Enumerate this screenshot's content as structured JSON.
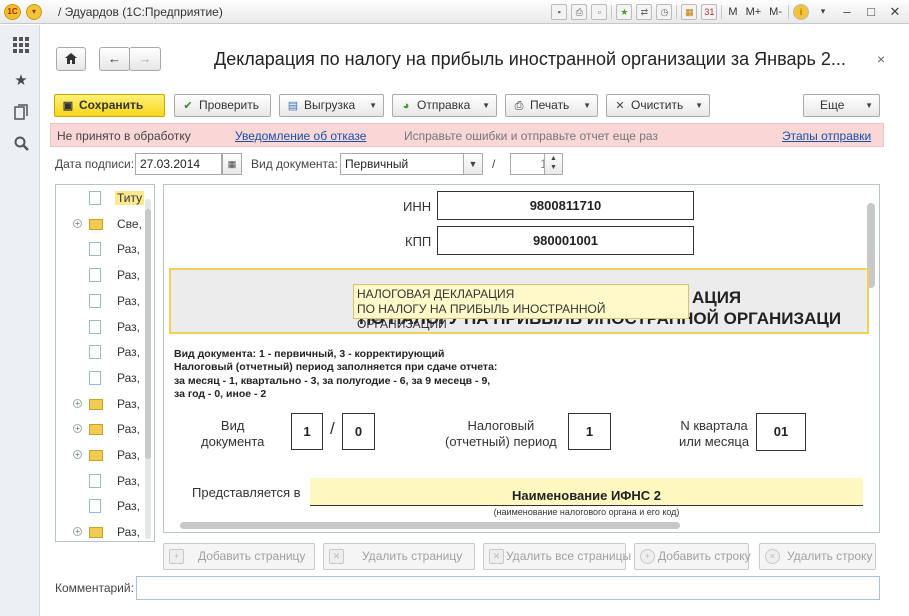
{
  "window": {
    "title": "/ Эдуардов  (1С:Предприятие)",
    "menu_m": "M",
    "menu_mplus": "M+",
    "menu_mminus": "M-"
  },
  "left_panel": {
    "items": [
      "apps-grid-icon",
      "star-icon",
      "history-icon",
      "search-icon"
    ]
  },
  "header": {
    "title": "Декларация по налогу на прибыль иностранной организации за Январь 2...",
    "home_icon": "home-icon",
    "back_icon": "arrow-left-icon",
    "forward_icon": "arrow-right-icon",
    "close": "×"
  },
  "toolbar": {
    "save": "Сохранить",
    "check": "Проверить",
    "export": "Выгрузка",
    "send": "Отправка",
    "print": "Печать",
    "clear": "Очистить",
    "more": "Еще"
  },
  "status": {
    "state": "Не принято в обработку",
    "notice_link": "Уведомление об отказе",
    "hint": "Исправьте ошибки и отправьте отчет еще раз",
    "stages_link": "Этапы отправки"
  },
  "form": {
    "date_label": "Дата подписи:",
    "date_value": "27.03.2014",
    "doc_type_label": "Вид документа:",
    "doc_type_value": "Первичный",
    "slash": "/",
    "correction_number": "1"
  },
  "tree": {
    "items": [
      {
        "label": "Титу",
        "kind": "doc",
        "expandable": false,
        "selected": true
      },
      {
        "label": "Све,",
        "kind": "folder",
        "expandable": true,
        "selected": false
      },
      {
        "label": "Раз,",
        "kind": "doc",
        "expandable": false,
        "selected": false
      },
      {
        "label": "Раз,",
        "kind": "doc",
        "expandable": false,
        "selected": false
      },
      {
        "label": "Раз,",
        "kind": "doc",
        "expandable": false,
        "selected": false
      },
      {
        "label": "Раз,",
        "kind": "doc",
        "expandable": false,
        "selected": false
      },
      {
        "label": "Раз,",
        "kind": "doc",
        "expandable": false,
        "selected": false
      },
      {
        "label": "Раз,",
        "kind": "doc",
        "expandable": false,
        "selected": false
      },
      {
        "label": "Раз,",
        "kind": "folder",
        "expandable": true,
        "selected": false
      },
      {
        "label": "Раз,",
        "kind": "folder",
        "expandable": true,
        "selected": false
      },
      {
        "label": "Раз,",
        "kind": "folder",
        "expandable": true,
        "selected": false
      },
      {
        "label": "Раз,",
        "kind": "doc",
        "expandable": false,
        "selected": false
      },
      {
        "label": "Раз,",
        "kind": "doc",
        "expandable": false,
        "selected": false
      },
      {
        "label": "Раз,",
        "kind": "folder",
        "expandable": true,
        "selected": false
      }
    ]
  },
  "document": {
    "inn_label": "ИНН",
    "inn_value": "9800811710",
    "kpp_label": "КПП",
    "kpp_value": "980001001",
    "title_line1_visible": "АЦИЯ",
    "title_line2": "ПО НАЛОГУ НА ПРИБЫЛЬ ИНОСТРАННОЙ ОРГАНИЗАЦИ",
    "tooltip_line1": "НАЛОГОВАЯ ДЕКЛАРАЦИЯ",
    "tooltip_line2": "ПО НАЛОГУ НА ПРИБЫЛЬ ИНОСТРАННОЙ ОРГАНИЗАЦИИ",
    "info_line1": "Вид документа: 1 - первичный, 3 - корректирующий",
    "info_line2": "Налоговый (отчетный) период заполняется при сдаче отчета:",
    "info_line3": "за месяц - 1, квартально - 3, за полугодие - 6, за 9 месецв - 9,",
    "info_line4": "за год - 0, иное - 2",
    "doc_type_label1": "Вид",
    "doc_type_label2": "документа",
    "doc_type_box1": "1",
    "doc_type_slash": "/",
    "doc_type_box2": "0",
    "period_label1": "Налоговый",
    "period_label2": "(отчетный) период",
    "period_value": "1",
    "quarter_label1": "N квартала",
    "quarter_label2": "или месяца",
    "quarter_value": "01",
    "submitted_label": "Представляется в",
    "ifns_name": "Наименование ИФНС 2",
    "ifns_sub": "(наименование налогового органа и его код)"
  },
  "page_buttons": {
    "add_page": "Добавить страницу",
    "delete_page": "Удалить страницу",
    "delete_all": "Удалить все страницы",
    "add_row": "Добавить строку",
    "delete_row": "Удалить строку"
  },
  "comment": {
    "label": "Комментарий:",
    "value": ""
  }
}
